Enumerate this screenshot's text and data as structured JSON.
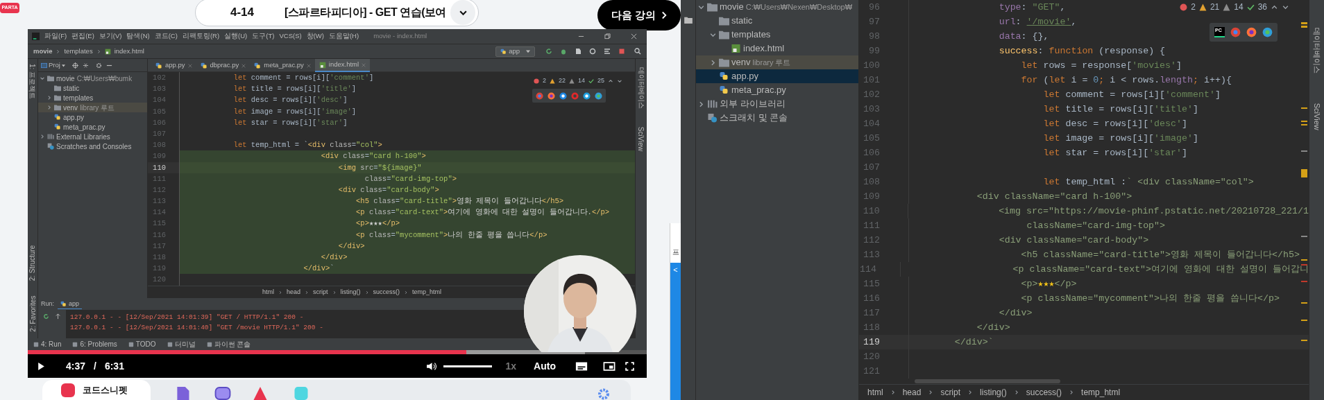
{
  "lecture_bar": {
    "logo": "PARTA",
    "number": "4-14",
    "title": "[스파르타피디아] - GET 연습(보여",
    "next_button": "다음 강의"
  },
  "video": {
    "ide": {
      "menu": [
        "파일(F)",
        "편집(E)",
        "보기(V)",
        "탐색(N)",
        "코드(C)",
        "리팩토링(R)",
        "실행(U)",
        "도구(T)",
        "VCS(S)",
        "창(W)",
        "도움말(H)"
      ],
      "window_title": "movie - index.html",
      "path": [
        "movie",
        "templates",
        "index.html"
      ],
      "run_config": "app",
      "left_strip": [
        "1: 프로젝트",
        "2: Structure",
        "2: Favorites"
      ],
      "right_strip": [
        "데이터베이스",
        "SciView"
      ],
      "project_header": "Proj",
      "tree": [
        {
          "label": "movie",
          "hint": "C:₩Users₩bumk",
          "kind": "folder",
          "expanded": true,
          "selected": false,
          "children": [
            {
              "label": "static",
              "kind": "folder",
              "selected": false
            },
            {
              "label": "templates",
              "kind": "folder",
              "expanded": false,
              "selected": false
            },
            {
              "label": "venv",
              "hint": "library 루트",
              "kind": "excluded_folder",
              "expanded": false,
              "selected": false
            },
            {
              "label": "app.py",
              "kind": "python",
              "selected": false
            },
            {
              "label": "meta_prac.py",
              "kind": "python",
              "selected": false
            }
          ]
        },
        {
          "label": "External Libraries",
          "kind": "libraries",
          "expanded": false,
          "selected": false
        },
        {
          "label": "Scratches and Consoles",
          "kind": "scratches",
          "selected": false
        }
      ],
      "tabs": [
        {
          "label": "app.py",
          "kind": "python",
          "selected": false
        },
        {
          "label": "dbprac.py",
          "kind": "python",
          "selected": false
        },
        {
          "label": "meta_prac.py",
          "kind": "python",
          "selected": false
        },
        {
          "label": "index.html",
          "kind": "html",
          "selected": true
        }
      ],
      "inspections": {
        "errors": "2",
        "warnings": "22",
        "weak_warnings": "14",
        "typos": "25"
      },
      "code_lines": [
        {
          "number": "102",
          "current": false,
          "template": false,
          "segments": [
            {
              "kind": "kw",
              "text": "            let"
            },
            {
              "kind": "plain",
              "text": " comment = rows[i]["
            },
            {
              "kind": "str",
              "text": "'comment'"
            },
            {
              "kind": "plain",
              "text": "]"
            }
          ]
        },
        {
          "number": "103",
          "current": false,
          "template": false,
          "segments": [
            {
              "kind": "kw",
              "text": "            let"
            },
            {
              "kind": "plain",
              "text": " title = rows[i]["
            },
            {
              "kind": "str",
              "text": "'title'"
            },
            {
              "kind": "plain",
              "text": "]"
            }
          ]
        },
        {
          "number": "104",
          "current": false,
          "template": false,
          "segments": [
            {
              "kind": "kw",
              "text": "            let"
            },
            {
              "kind": "plain",
              "text": " desc = rows[i]["
            },
            {
              "kind": "str",
              "text": "'desc'"
            },
            {
              "kind": "plain",
              "text": "]"
            }
          ]
        },
        {
          "number": "105",
          "current": false,
          "template": false,
          "segments": [
            {
              "kind": "kw",
              "text": "            let"
            },
            {
              "kind": "plain",
              "text": " image = rows[i]["
            },
            {
              "kind": "str",
              "text": "'image'"
            },
            {
              "kind": "plain",
              "text": "]"
            }
          ]
        },
        {
          "number": "106",
          "current": false,
          "template": false,
          "segments": [
            {
              "kind": "kw",
              "text": "            let"
            },
            {
              "kind": "plain",
              "text": " star = rows[i]["
            },
            {
              "kind": "str",
              "text": "'star'"
            },
            {
              "kind": "plain",
              "text": "]"
            }
          ]
        },
        {
          "number": "107",
          "current": false
        },
        {
          "number": "108",
          "current": false,
          "template": false,
          "segments": [
            {
              "kind": "kw",
              "text": "            let"
            },
            {
              "kind": "plain",
              "text": " temp_html = `"
            },
            {
              "kind": "tag",
              "text": "<div "
            },
            {
              "kind": "attr",
              "text": "class"
            },
            {
              "kind": "plain",
              "text": "="
            },
            {
              "kind": "val",
              "text": "\"col\""
            },
            {
              "kind": "tag",
              "text": ">"
            }
          ]
        },
        {
          "number": "109",
          "current": false,
          "template": true,
          "segments": [
            {
              "kind": "tag",
              "text": "                                <div "
            },
            {
              "kind": "attr",
              "text": "class"
            },
            {
              "kind": "plain",
              "text": "="
            },
            {
              "kind": "val",
              "text": "\"card h-100\""
            },
            {
              "kind": "tag",
              "text": ">"
            }
          ]
        },
        {
          "number": "110",
          "current": true,
          "template": true,
          "segments": [
            {
              "kind": "tag",
              "text": "                                    <img "
            },
            {
              "kind": "attr",
              "text": "src"
            },
            {
              "kind": "plain",
              "text": "="
            },
            {
              "kind": "val",
              "text": "\"${image}\""
            }
          ]
        },
        {
          "number": "111",
          "current": false,
          "template": true,
          "segments": [
            {
              "kind": "attr",
              "text": "                                          class"
            },
            {
              "kind": "plain",
              "text": "="
            },
            {
              "kind": "val",
              "text": "\"card-img-top\""
            },
            {
              "kind": "tag",
              "text": ">"
            }
          ]
        },
        {
          "number": "112",
          "current": false,
          "template": true,
          "segments": [
            {
              "kind": "tag",
              "text": "                                    <div "
            },
            {
              "kind": "attr",
              "text": "class"
            },
            {
              "kind": "plain",
              "text": "="
            },
            {
              "kind": "val",
              "text": "\"card-body\""
            },
            {
              "kind": "tag",
              "text": ">"
            }
          ]
        },
        {
          "number": "113",
          "current": false,
          "template": true,
          "segments": [
            {
              "kind": "tag",
              "text": "                                        <h5 "
            },
            {
              "kind": "attr",
              "text": "class"
            },
            {
              "kind": "plain",
              "text": "="
            },
            {
              "kind": "val",
              "text": "\"card-title\""
            },
            {
              "kind": "tag",
              "text": ">"
            },
            {
              "kind": "text",
              "text": "영화 제목이 들어갑니다"
            },
            {
              "kind": "tag",
              "text": "</h5>"
            }
          ]
        },
        {
          "number": "114",
          "current": false,
          "template": true,
          "segments": [
            {
              "kind": "tag",
              "text": "                                        <p "
            },
            {
              "kind": "attr",
              "text": "class"
            },
            {
              "kind": "plain",
              "text": "="
            },
            {
              "kind": "val",
              "text": "\"card-text\""
            },
            {
              "kind": "tag",
              "text": ">"
            },
            {
              "kind": "text",
              "text": "여기에 영화에 대한 설명이 들어갑니다."
            },
            {
              "kind": "tag",
              "text": "</p>"
            }
          ]
        },
        {
          "number": "115",
          "current": false,
          "template": true,
          "segments": [
            {
              "kind": "tag",
              "text": "                                        <p>"
            },
            {
              "kind": "text",
              "text": "★★★"
            },
            {
              "kind": "tag",
              "text": "</p>"
            }
          ]
        },
        {
          "number": "116",
          "current": false,
          "template": true,
          "segments": [
            {
              "kind": "tag",
              "text": "                                        <p "
            },
            {
              "kind": "attr",
              "text": "class"
            },
            {
              "kind": "plain",
              "text": "="
            },
            {
              "kind": "val",
              "text": "\"mycomment\""
            },
            {
              "kind": "tag",
              "text": ">"
            },
            {
              "kind": "text",
              "text": "나의 한줄 평을 씁니다"
            },
            {
              "kind": "tag",
              "text": "</p>"
            }
          ]
        },
        {
          "number": "117",
          "current": false,
          "template": true,
          "segments": [
            {
              "kind": "tag",
              "text": "                                    </div>"
            }
          ]
        },
        {
          "number": "118",
          "current": false,
          "template": true,
          "segments": [
            {
              "kind": "tag",
              "text": "                                </div>"
            }
          ]
        },
        {
          "number": "119",
          "current": false,
          "template": true,
          "segments": [
            {
              "kind": "tag",
              "text": "                            </div>"
            },
            {
              "kind": "plain",
              "text": "`"
            }
          ]
        },
        {
          "number": "120",
          "current": false
        }
      ],
      "code_path": [
        "html",
        "head",
        "script",
        "listing()",
        "success()",
        "temp_html"
      ],
      "run": {
        "label": "Run:",
        "config": "app",
        "log": [
          "127.0.0.1 - - [12/Sep/2021 14:01:39] \"GET / HTTP/1.1\" 200 -",
          "127.0.0.1 - - [12/Sep/2021 14:01:40] \"GET /movie HTTP/1.1\" 200 -"
        ]
      },
      "bottom_tabs": [
        "4: Run",
        "6: Problems",
        "TODO",
        "터미널",
        "파이썬 콘솔"
      ]
    },
    "player": {
      "current_time": "4:37",
      "separator": "/",
      "duration": "6:31",
      "progress": {
        "level": 0.708
      },
      "buffered": {
        "level": 0.9
      },
      "volume": {
        "level": 1
      },
      "speed": "1x",
      "quality": "Auto"
    }
  },
  "bottom_toolbar": {
    "snippet_label": "코드스니펫"
  },
  "peek_window": {
    "text": "프",
    "button": "<"
  },
  "ide": {
    "tree": [
      {
        "label": "movie",
        "hint": "C:₩Users₩Nexen₩Desktop₩",
        "kind": "folder",
        "expanded": true,
        "selected": false,
        "children": [
          {
            "label": "static",
            "kind": "folder",
            "selected": false
          },
          {
            "label": "templates",
            "kind": "folder",
            "expanded": true,
            "selected": false,
            "children": [
              {
                "label": "index.html",
                "kind": "html",
                "selected": false
              }
            ]
          },
          {
            "label": "venv",
            "hint": "library 루트",
            "kind": "excluded_folder",
            "expanded": false,
            "selected": false
          },
          {
            "label": "app.py",
            "kind": "python",
            "selected": true
          },
          {
            "label": "meta_prac.py",
            "kind": "python",
            "selected": false
          }
        ]
      },
      {
        "label": "외부 라이브러리",
        "kind": "libraries",
        "expanded": false,
        "selected": false
      },
      {
        "label": "스크래치 및 콘솔",
        "kind": "scratches",
        "selected": false
      }
    ],
    "inspections": {
      "errors": "2",
      "warnings": "21",
      "weak_warnings": "14",
      "typos": "36"
    },
    "popup_label": "PC",
    "right_strip": [
      "데이터베이스",
      "SciView"
    ],
    "code_lines": [
      {
        "number": "96",
        "current": false,
        "segments": [
          {
            "kind": "prop",
            "text": "                type"
          },
          {
            "kind": "plain",
            "text": ": "
          },
          {
            "kind": "str",
            "text": "\"GET\""
          },
          {
            "kind": "plain",
            "text": ","
          }
        ]
      },
      {
        "number": "97",
        "current": false,
        "segments": [
          {
            "kind": "prop",
            "text": "                url"
          },
          {
            "kind": "plain",
            "text": ": "
          },
          {
            "kind": "link",
            "text": "'/movie'"
          },
          {
            "kind": "plain",
            "text": ","
          }
        ]
      },
      {
        "number": "98",
        "current": false,
        "segments": [
          {
            "kind": "prop",
            "text": "                data"
          },
          {
            "kind": "plain",
            "text": ": {},"
          }
        ]
      },
      {
        "number": "99",
        "current": false,
        "segments": [
          {
            "kind": "fn",
            "text": "                success"
          },
          {
            "kind": "plain",
            "text": ": "
          },
          {
            "kind": "kw",
            "text": "function"
          },
          {
            "kind": "plain",
            "text": " (response) {"
          }
        ]
      },
      {
        "number": "100",
        "current": false,
        "segments": [
          {
            "kind": "kw",
            "text": "                    let"
          },
          {
            "kind": "plain",
            "text": " rows = response["
          },
          {
            "kind": "str",
            "text": "'movies'"
          },
          {
            "kind": "plain",
            "text": "]"
          }
        ]
      },
      {
        "number": "101",
        "current": false,
        "segments": [
          {
            "kind": "kw",
            "text": "                    for"
          },
          {
            "kind": "plain",
            "text": " ("
          },
          {
            "kind": "kw",
            "text": "let"
          },
          {
            "kind": "plain",
            "text": " i = "
          },
          {
            "kind": "num",
            "text": "0"
          },
          {
            "kind": "kw",
            "text": ";"
          },
          {
            "kind": "plain",
            "text": " i < rows."
          },
          {
            "kind": "prop",
            "text": "length"
          },
          {
            "kind": "kw",
            "text": ";"
          },
          {
            "kind": "plain",
            "text": " i++){"
          }
        ]
      },
      {
        "number": "102",
        "current": false,
        "segments": [
          {
            "kind": "kw",
            "text": "                        let"
          },
          {
            "kind": "plain",
            "text": " comment = rows[i]["
          },
          {
            "kind": "str",
            "text": "'comment'"
          },
          {
            "kind": "plain",
            "text": "]"
          }
        ]
      },
      {
        "number": "103",
        "current": false,
        "segments": [
          {
            "kind": "kw",
            "text": "                        let"
          },
          {
            "kind": "plain",
            "text": " title = rows[i]["
          },
          {
            "kind": "str",
            "text": "'title'"
          },
          {
            "kind": "plain",
            "text": "]"
          }
        ]
      },
      {
        "number": "104",
        "current": false,
        "segments": [
          {
            "kind": "kw",
            "text": "                        let"
          },
          {
            "kind": "plain",
            "text": " desc = rows[i]["
          },
          {
            "kind": "str",
            "text": "'desc'"
          },
          {
            "kind": "plain",
            "text": "]"
          }
        ]
      },
      {
        "number": "105",
        "current": false,
        "segments": [
          {
            "kind": "kw",
            "text": "                        let"
          },
          {
            "kind": "plain",
            "text": " image = rows[i]["
          },
          {
            "kind": "str",
            "text": "'image'"
          },
          {
            "kind": "plain",
            "text": "]"
          }
        ]
      },
      {
        "number": "106",
        "current": false,
        "segments": [
          {
            "kind": "kw",
            "text": "                        let"
          },
          {
            "kind": "plain",
            "text": " star = rows[i]["
          },
          {
            "kind": "str",
            "text": "'star'"
          },
          {
            "kind": "plain",
            "text": "]"
          }
        ]
      },
      {
        "number": "107",
        "current": false
      },
      {
        "number": "108",
        "current": false,
        "segments": [
          {
            "kind": "kw",
            "text": "                        let"
          },
          {
            "kind": "plain",
            "text": " temp_html :"
          },
          {
            "kind": "tpl",
            "text": "` <div className=\"col\">"
          }
        ]
      },
      {
        "number": "109",
        "current": false,
        "segments": [
          {
            "kind": "tpl",
            "text": "            <div className=\"card h-100\">"
          }
        ]
      },
      {
        "number": "110",
        "current": false,
        "segments": [
          {
            "kind": "tpl",
            "text": "                <img src=\"https://movie-phinf.pstatic.net/20210728_221/1"
          }
        ]
      },
      {
        "number": "111",
        "current": false,
        "segments": [
          {
            "kind": "tpl",
            "text": "                     className=\"card-img-top\">"
          }
        ]
      },
      {
        "number": "112",
        "current": false,
        "segments": [
          {
            "kind": "tpl",
            "text": "                <div className=\"card-body\">"
          }
        ]
      },
      {
        "number": "113",
        "current": false,
        "segments": [
          {
            "kind": "tpl",
            "text": "                    <h5 className=\"card-title\">영화 제목이 들어갑니다</h5>"
          }
        ]
      },
      {
        "number": "114",
        "current": false,
        "segments": [
          {
            "kind": "tpl",
            "text": "                    <p className=\"card-text\">여기에 영화에 대한 설명이 들어갑니"
          }
        ]
      },
      {
        "number": "115",
        "current": false,
        "segments": [
          {
            "kind": "tpl",
            "text": "                    <p>"
          },
          {
            "kind": "star",
            "text": "★★★"
          },
          {
            "kind": "tpl",
            "text": "</p>"
          }
        ]
      },
      {
        "number": "116",
        "current": false,
        "segments": [
          {
            "kind": "tpl",
            "text": "                    <p className=\"mycomment\">나의 한줄 평을 씁니다</p>"
          }
        ]
      },
      {
        "number": "117",
        "current": false,
        "segments": [
          {
            "kind": "tpl",
            "text": "                </div>"
          }
        ]
      },
      {
        "number": "118",
        "current": false,
        "segments": [
          {
            "kind": "tpl",
            "text": "            </div>"
          }
        ]
      },
      {
        "number": "119",
        "current": true,
        "segments": [
          {
            "kind": "tpl",
            "text": "        </div>`"
          }
        ]
      },
      {
        "number": "120",
        "current": false
      },
      {
        "number": "121",
        "current": false
      }
    ],
    "code_path": [
      "html",
      "head",
      "script",
      "listing()",
      "success()",
      "temp_html"
    ]
  }
}
